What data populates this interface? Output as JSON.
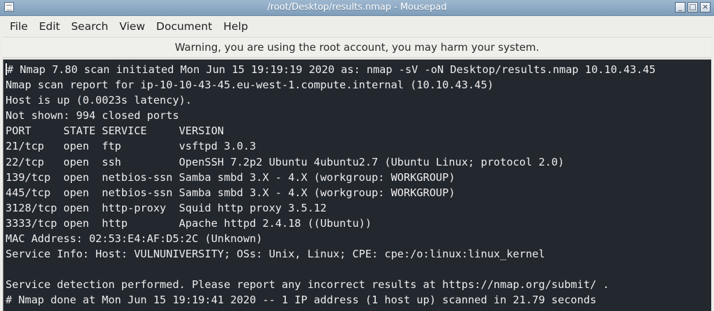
{
  "window": {
    "title": "/root/Desktop/results.nmap - Mousepad",
    "controls": [
      "_",
      "□",
      "×"
    ]
  },
  "menubar": {
    "items": [
      "File",
      "Edit",
      "Search",
      "View",
      "Document",
      "Help"
    ]
  },
  "warning": {
    "text": "Warning, you are using the root account, you may harm your system."
  },
  "editor": {
    "lines": [
      "# Nmap 7.80 scan initiated Mon Jun 15 19:19:19 2020 as: nmap -sV -oN Desktop/results.nmap 10.10.43.45",
      "Nmap scan report for ip-10-10-43-45.eu-west-1.compute.internal (10.10.43.45)",
      "Host is up (0.0023s latency).",
      "Not shown: 994 closed ports",
      "PORT     STATE SERVICE     VERSION",
      "21/tcp   open  ftp         vsftpd 3.0.3",
      "22/tcp   open  ssh         OpenSSH 7.2p2 Ubuntu 4ubuntu2.7 (Ubuntu Linux; protocol 2.0)",
      "139/tcp  open  netbios-ssn Samba smbd 3.X - 4.X (workgroup: WORKGROUP)",
      "445/tcp  open  netbios-ssn Samba smbd 3.X - 4.X (workgroup: WORKGROUP)",
      "3128/tcp open  http-proxy  Squid http proxy 3.5.12",
      "3333/tcp open  http        Apache httpd 2.4.18 ((Ubuntu))",
      "MAC Address: 02:53:E4:AF:D5:2C (Unknown)",
      "Service Info: Host: VULNUNIVERSITY; OSs: Unix, Linux; CPE: cpe:/o:linux:linux_kernel",
      "",
      "Service detection performed. Please report any incorrect results at https://nmap.org/submit/ .",
      "# Nmap done at Mon Jun 15 19:19:41 2020 -- 1 IP address (1 host up) scanned in 21.79 seconds"
    ]
  },
  "colors": {
    "titlebar": "#8eaac4",
    "editor_background": "#23272e",
    "editor_text": "#eeeeee"
  }
}
